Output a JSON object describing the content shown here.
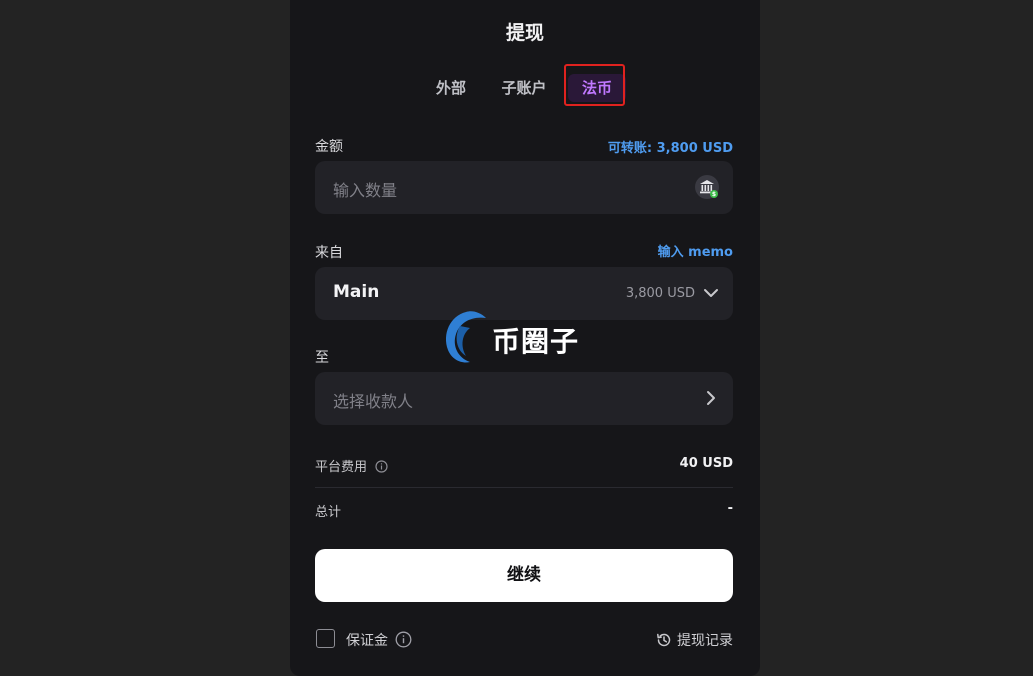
{
  "header": {
    "title": "提现"
  },
  "tabs": [
    {
      "label": "外部"
    },
    {
      "label": "子账户"
    },
    {
      "label": "法币",
      "active": true
    }
  ],
  "amount": {
    "label": "金额",
    "available": "可转账: 3,800 USD",
    "placeholder": "输入数量",
    "icon": "bank-icon"
  },
  "from": {
    "label": "来自",
    "memo_link": "输入 memo",
    "account_name": "Main",
    "account_balance": "3,800 USD",
    "icon": "chevron-down-icon"
  },
  "to": {
    "label": "至",
    "placeholder": "选择收款人",
    "icon": "chevron-right-icon"
  },
  "fees": {
    "platform_fee_label": "平台费用",
    "platform_fee_value": "40 USD",
    "total_label": "总计",
    "total_value": "-"
  },
  "actions": {
    "continue_label": "继续",
    "margin_label": "保证金",
    "history_label": "提现记录"
  },
  "watermark": {
    "text": "币圈子"
  },
  "colors": {
    "accent_blue": "#4f9cf0",
    "active_tab": "#c078ff",
    "highlight_border": "#e0221f"
  }
}
